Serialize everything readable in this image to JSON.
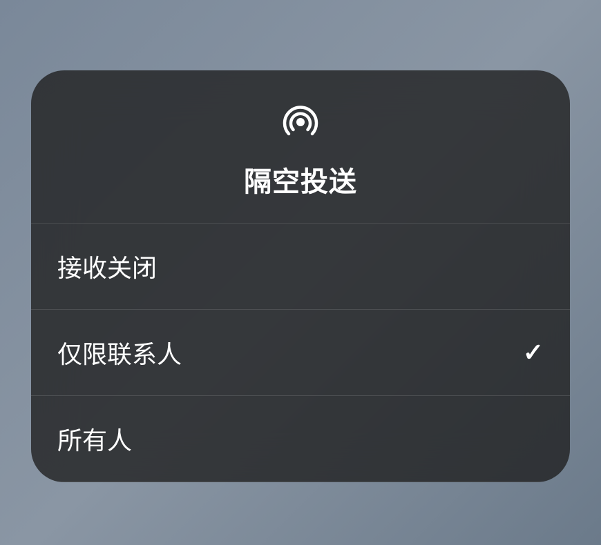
{
  "header": {
    "title": "隔空投送"
  },
  "options": [
    {
      "label": "接收关闭",
      "selected": false
    },
    {
      "label": "仅限联系人",
      "selected": true
    },
    {
      "label": "所有人",
      "selected": false
    }
  ]
}
